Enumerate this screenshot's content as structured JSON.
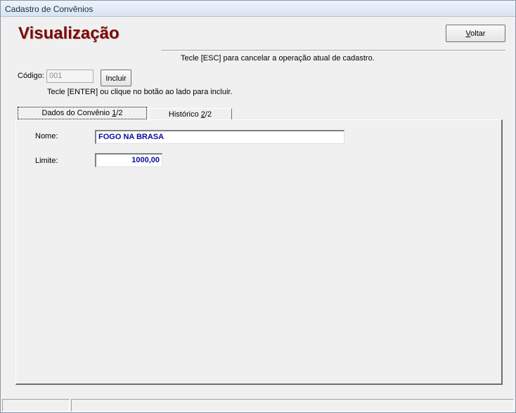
{
  "window": {
    "title": "Cadastro de Convênios"
  },
  "header": {
    "heading": "Visualização",
    "voltar_label": "Voltar",
    "esc_hint": "Tecle [ESC] para cancelar a operação atual de cadastro."
  },
  "codigo": {
    "label": "Código:",
    "value": "001",
    "incluir_label": "Incluir",
    "enter_hint": "Tecle [ENTER] ou clique no botão ao lado para incluir."
  },
  "tabs": [
    {
      "label_pre": "Dados do Convênio ",
      "label_ul": "1",
      "label_post": "/2",
      "active": true
    },
    {
      "label_pre": "Histórico ",
      "label_ul": "2",
      "label_post": "/2",
      "active": false
    }
  ],
  "form": {
    "nome_label": "Nome:",
    "nome_value": "FOGO NA BRASA",
    "limite_label": "Limite:",
    "limite_value": "1000,00"
  },
  "colors": {
    "heading": "#7a0a0a",
    "field_text": "#0a0a9a"
  }
}
